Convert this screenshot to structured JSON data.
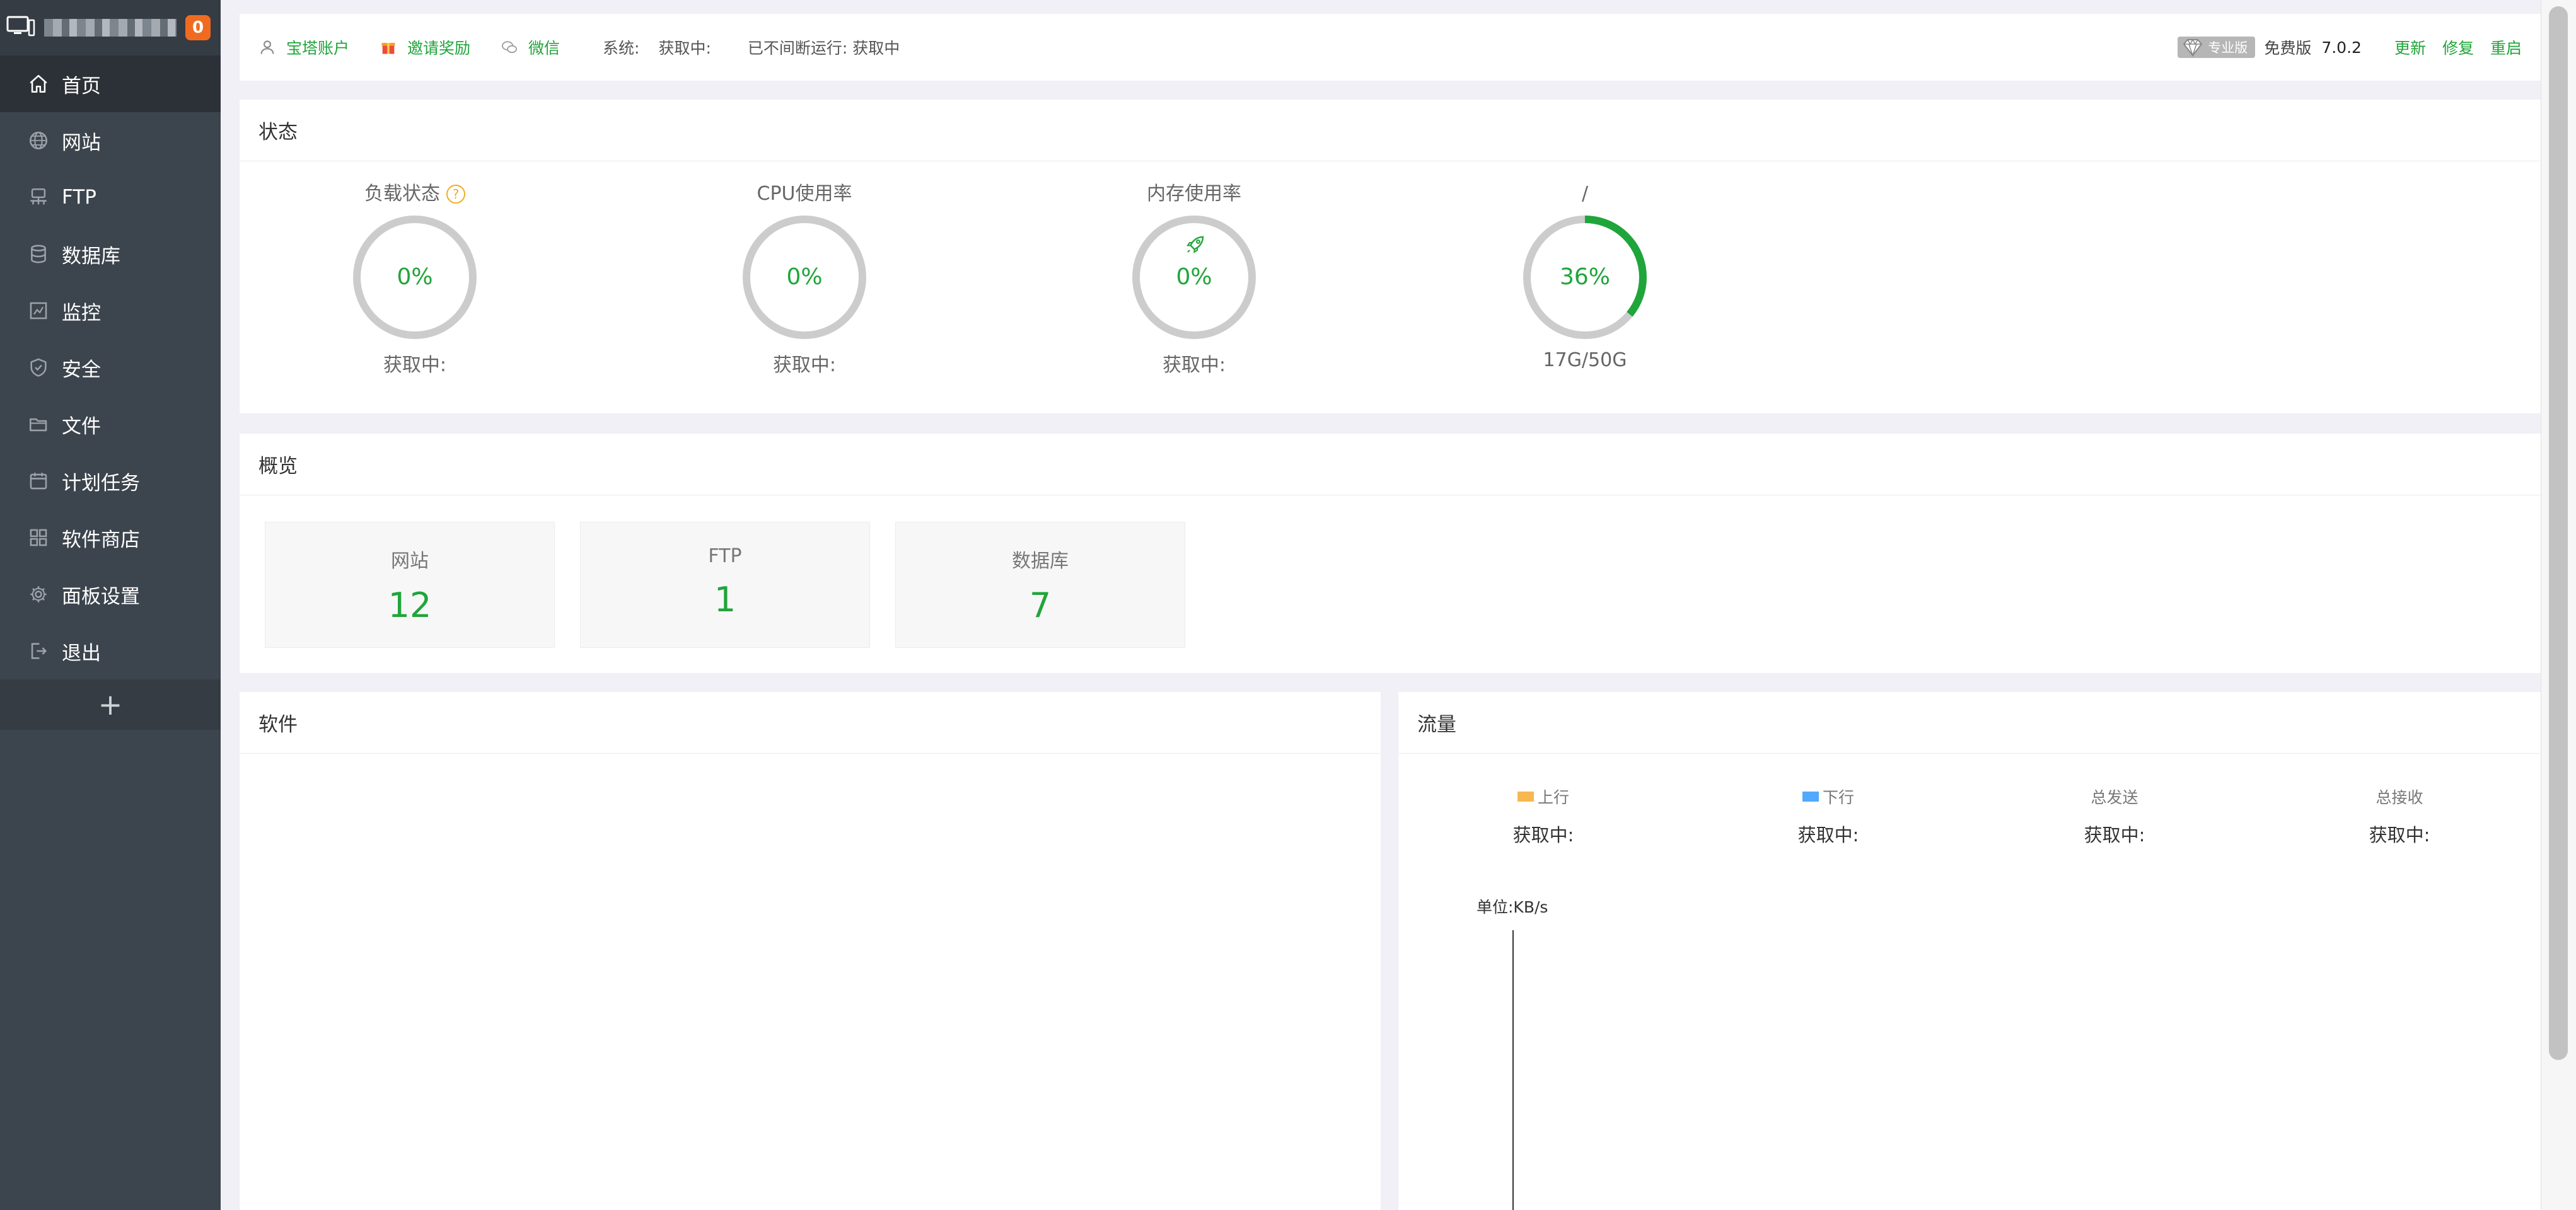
{
  "sidebar": {
    "badge": "0",
    "items": [
      {
        "label": "首页",
        "icon": "home-icon"
      },
      {
        "label": "网站",
        "icon": "globe-icon"
      },
      {
        "label": "FTP",
        "icon": "ftp-icon"
      },
      {
        "label": "数据库",
        "icon": "database-icon"
      },
      {
        "label": "监控",
        "icon": "monitor-icon"
      },
      {
        "label": "安全",
        "icon": "shield-icon"
      },
      {
        "label": "文件",
        "icon": "folder-icon"
      },
      {
        "label": "计划任务",
        "icon": "calendar-icon"
      },
      {
        "label": "软件商店",
        "icon": "grid-icon"
      },
      {
        "label": "面板设置",
        "icon": "gear-icon"
      },
      {
        "label": "退出",
        "icon": "logout-icon"
      }
    ],
    "add_label": "+"
  },
  "topbar": {
    "account": "宝塔账户",
    "invite": "邀请奖励",
    "wechat": "微信",
    "system_label": "系统:",
    "system_value": "获取中:",
    "uptime": "已不间断运行: 获取中",
    "pro_label": "专业版",
    "free_label": "免费版",
    "version": "7.0.2",
    "update": "更新",
    "repair": "修复",
    "restart": "重启"
  },
  "status": {
    "title": "状态",
    "gauges": [
      {
        "title": "负载状态",
        "value": "0%",
        "sub": "获取中:",
        "fraction": 0
      },
      {
        "title": "CPU使用率",
        "value": "0%",
        "sub": "获取中:",
        "fraction": 0
      },
      {
        "title": "内存使用率",
        "value": "0%",
        "sub": "获取中:",
        "fraction": 0
      },
      {
        "title": "/",
        "value": "36%",
        "sub": "17G/50G",
        "fraction": 0.36
      }
    ]
  },
  "overview": {
    "title": "概览",
    "boxes": [
      {
        "label": "网站",
        "value": "12"
      },
      {
        "label": "FTP",
        "value": "1"
      },
      {
        "label": "数据库",
        "value": "7"
      }
    ]
  },
  "software": {
    "title": "软件"
  },
  "traffic": {
    "title": "流量",
    "stats": [
      {
        "label": "上行",
        "value": "获取中:",
        "swatch": "#f7b851"
      },
      {
        "label": "下行",
        "value": "获取中:",
        "swatch": "#52a9ff"
      },
      {
        "label": "总发送",
        "value": "获取中:"
      },
      {
        "label": "总接收",
        "value": "获取中:"
      }
    ],
    "unit": "单位:KB/s"
  },
  "colors": {
    "accent": "#20a53a",
    "sidebar_bg": "#3c444d",
    "sidebar_active": "#2c3137",
    "badge": "#f06b20"
  }
}
